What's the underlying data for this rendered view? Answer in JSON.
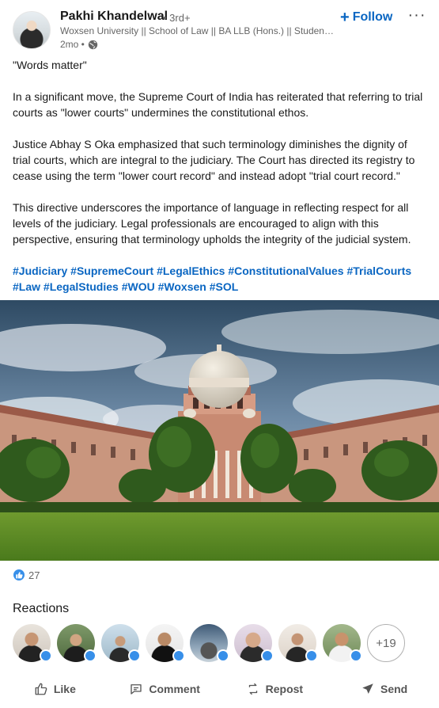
{
  "post": {
    "author": {
      "name": "Pakhi Khandelwal",
      "degree": "• 3rd+",
      "headline": "Woxsen University || School of Law || BA LLB (Hons.) || Student A...",
      "time": "2mo •",
      "visibility_icon": "globe-icon"
    },
    "follow_label": "Follow",
    "follow_icon": "+",
    "more_label": "···",
    "text": {
      "p1": "\"Words matter\"",
      "p2": "In a significant move, the Supreme Court of India has reiterated that referring to trial courts as \"lower courts\" undermines the constitutional ethos.",
      "p3": "Justice Abhay S Oka emphasized that such terminology diminishes the dignity of trial courts, which are integral to the judiciary. The Court has directed its registry to cease using the term \"lower court record\" and instead adopt \"trial court record.\"",
      "p4": "This directive underscores the importance of language in reflecting respect for all levels of the judiciary. Legal professionals are encouraged to align with this perspective, ensuring that terminology upholds the integrity of the judicial system."
    },
    "hashtags": [
      "#Judiciary",
      "#SupremeCourt",
      "#LegalEthics",
      "#ConstitutionalValues",
      "#TrialCourts",
      "#Law",
      "#LegalStudies",
      "#WOU",
      "#Woxsen",
      "#SOL"
    ]
  },
  "social": {
    "reaction_count": "27",
    "reaction_icon": "like-icon"
  },
  "reactions": {
    "title": "Reactions",
    "more_count": "+19"
  },
  "actions": {
    "like": "Like",
    "comment": "Comment",
    "repost": "Repost",
    "send": "Send"
  },
  "colors": {
    "link_blue": "#0a66c2",
    "like_blue": "#378fe9",
    "muted_text": "#666666"
  }
}
